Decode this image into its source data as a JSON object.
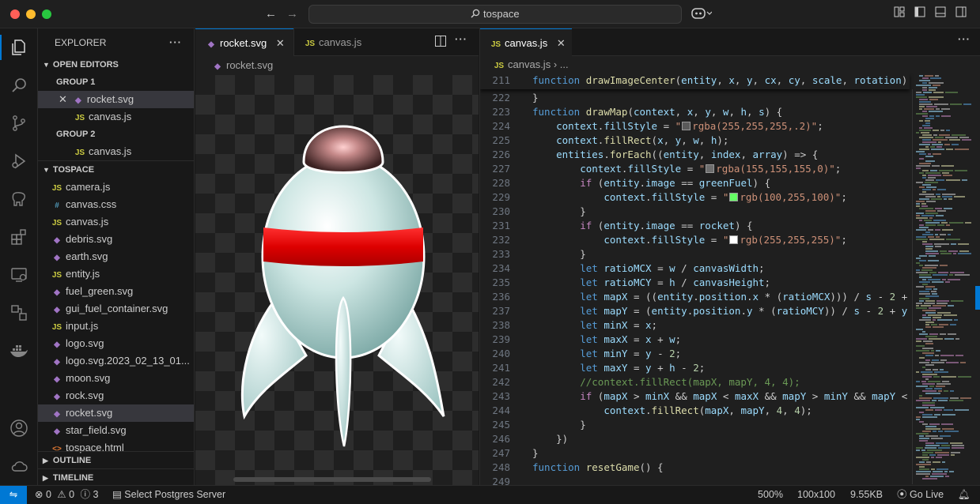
{
  "search": {
    "text": "tospace"
  },
  "sidebar": {
    "title": "EXPLORER",
    "open_editors": "OPEN EDITORS",
    "group1": "GROUP 1",
    "group1_files": [
      "rocket.svg",
      "canvas.js"
    ],
    "group2": "GROUP 2",
    "group2_files": [
      "canvas.js"
    ],
    "project": "TOSPACE",
    "files": [
      {
        "name": "camera.js",
        "type": "js"
      },
      {
        "name": "canvas.css",
        "type": "css"
      },
      {
        "name": "canvas.js",
        "type": "js"
      },
      {
        "name": "debris.svg",
        "type": "svg"
      },
      {
        "name": "earth.svg",
        "type": "svg"
      },
      {
        "name": "entity.js",
        "type": "js"
      },
      {
        "name": "fuel_green.svg",
        "type": "svg"
      },
      {
        "name": "gui_fuel_container.svg",
        "type": "svg"
      },
      {
        "name": "input.js",
        "type": "js"
      },
      {
        "name": "logo.svg",
        "type": "svg"
      },
      {
        "name": "logo.svg.2023_02_13_01...",
        "type": "svg"
      },
      {
        "name": "moon.svg",
        "type": "svg"
      },
      {
        "name": "rock.svg",
        "type": "svg"
      },
      {
        "name": "rocket.svg",
        "type": "svg"
      },
      {
        "name": "star_field.svg",
        "type": "svg"
      },
      {
        "name": "tospace.html",
        "type": "html"
      }
    ],
    "outline": "OUTLINE",
    "timeline": "TIMELINE"
  },
  "editor1": {
    "tabs": [
      "rocket.svg",
      "canvas.js"
    ],
    "breadcrumb": "rocket.svg"
  },
  "editor2": {
    "tab": "canvas.js",
    "breadcrumb_file": "canvas.js",
    "breadcrumb_rest": "...",
    "sticky": {
      "num": "211",
      "code": "function drawImageCenter(entity, x, y, cx, cy, scale, rotation) {"
    },
    "lines": [
      {
        "num": "222",
        "code": "}"
      },
      {
        "num": "223",
        "code": "function drawMap(context, x, y, w, h, s) {"
      },
      {
        "num": "224",
        "code": "    context.fillStyle = \"rgba(255,255,255,.2)\";"
      },
      {
        "num": "225",
        "code": "    context.fillRect(x, y, w, h);"
      },
      {
        "num": "226",
        "code": "    entities.forEach((entity, index, array) => {"
      },
      {
        "num": "227",
        "code": "        context.fillStyle = \"rgba(155,155,155,0)\";"
      },
      {
        "num": "228",
        "code": "        if (entity.image == greenFuel) {"
      },
      {
        "num": "229",
        "code": "            context.fillStyle = \"rgb(100,255,100)\";"
      },
      {
        "num": "230",
        "code": "        }"
      },
      {
        "num": "231",
        "code": "        if (entity.image == rocket) {"
      },
      {
        "num": "232",
        "code": "            context.fillStyle = \"rgb(255,255,255)\";"
      },
      {
        "num": "233",
        "code": "        }"
      },
      {
        "num": "234",
        "code": "        let ratioMCX = w / canvasWidth;"
      },
      {
        "num": "235",
        "code": "        let ratioMCY = h / canvasHeight;"
      },
      {
        "num": "236",
        "code": "        let mapX = ((entity.position.x * (ratioMCX))) / s - 2 + x"
      },
      {
        "num": "237",
        "code": "        let mapY = (entity.position.y * (ratioMCY)) / s - 2 + y -"
      },
      {
        "num": "238",
        "code": "        let minX = x;"
      },
      {
        "num": "239",
        "code": "        let maxX = x + w;"
      },
      {
        "num": "240",
        "code": "        let minY = y - 2;"
      },
      {
        "num": "241",
        "code": "        let maxY = y + h - 2;"
      },
      {
        "num": "242",
        "code": "        //context.fillRect(mapX, mapY, 4, 4);"
      },
      {
        "num": "243",
        "code": "        if (mapX > minX && mapX < maxX && mapY > minY && mapY < max"
      },
      {
        "num": "244",
        "code": "            context.fillRect(mapX, mapY, 4, 4);"
      },
      {
        "num": "245",
        "code": "        }"
      },
      {
        "num": "246",
        "code": "    })"
      },
      {
        "num": "247",
        "code": "}"
      },
      {
        "num": "248",
        "code": "function resetGame() {"
      },
      {
        "num": "249",
        "code": ""
      }
    ]
  },
  "status": {
    "errors": "0",
    "warnings": "0",
    "info": "3",
    "postgres": "Select Postgres Server",
    "zoom": "500%",
    "dimensions": "100x100",
    "size": "9.55KB",
    "golive": "Go Live"
  },
  "colors": {
    "swatch1": "#5a5a5a",
    "swatch2": "#6e6e6e",
    "swatch3": "#64ff64",
    "swatch4": "#ffffff"
  }
}
